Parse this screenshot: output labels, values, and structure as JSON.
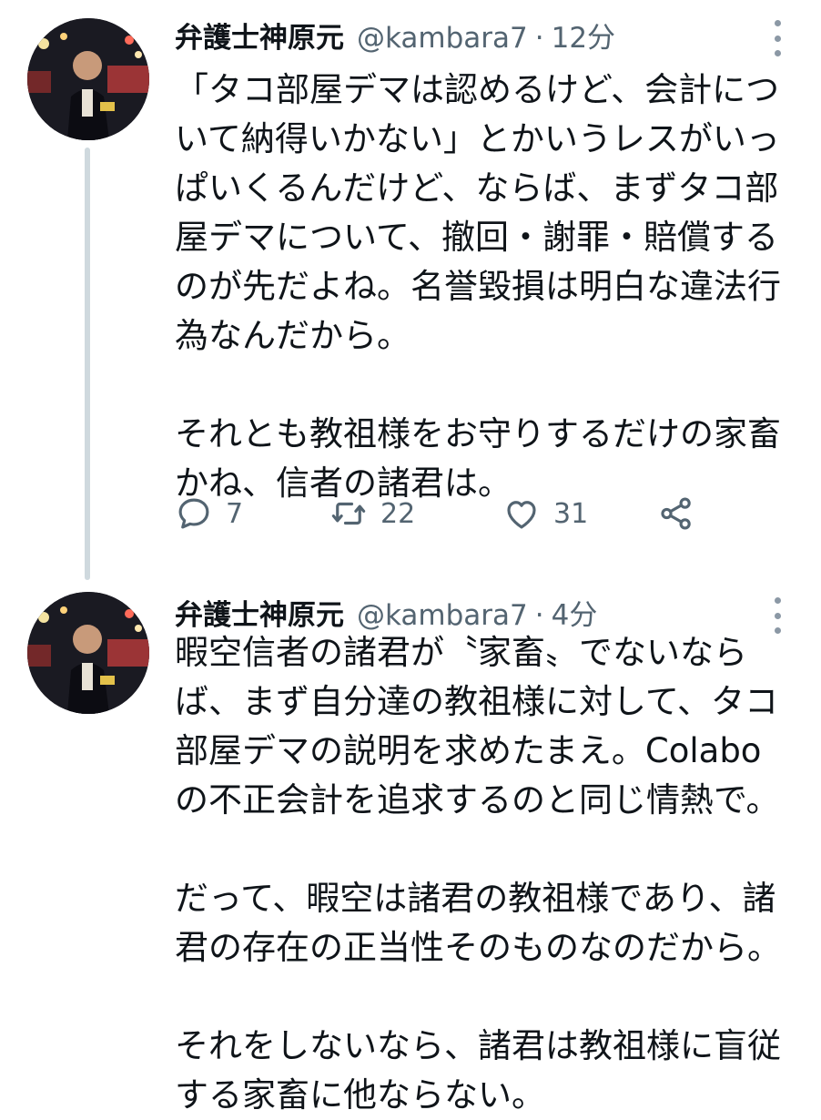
{
  "tweets": [
    {
      "display_name": "弁護士神原元",
      "handle": "@kambara7",
      "separator": "·",
      "time": "12分",
      "lines": [
        "「タコ部屋デマは認めるけど、会計につ",
        "いて納得いかない」とかいうレスがいっ",
        "ぱいくるんだけど、ならば、まずタコ部",
        "屋デマについて、撤回・謝罪・賠償する",
        "のが先だよね。名誉毀損は明白な違法行",
        "為なんだから。",
        "",
        "それとも教祖様をお守りするだけの家畜",
        "かね、信者の諸君は。"
      ],
      "replies": "7",
      "retweets": "22",
      "likes": "31"
    },
    {
      "display_name": "弁護士神原元",
      "handle": "@kambara7",
      "separator": "·",
      "time": "4分",
      "lines": [
        "暇空信者の諸君が〝家畜〟でないなら",
        "ば、まず自分達の教祖様に対して、タコ",
        "部屋デマの説明を求めたまえ。Colabo",
        "の不正会計を追求するのと同じ情熱で。",
        "",
        "だって、暇空は諸君の教祖様であり、諸",
        "君の存在の正当性そのものなのだから。",
        "",
        "それをしないなら、諸君は教祖様に盲従",
        "する家畜に他ならない。"
      ]
    }
  ],
  "icons": {
    "reply": "reply-icon",
    "retweet": "retweet-icon",
    "like": "like-icon",
    "share": "share-icon",
    "more": "more-options-icon"
  },
  "colors": {
    "text": "#0f1419",
    "secondary": "#536471",
    "thread_line": "#cfd9de"
  }
}
